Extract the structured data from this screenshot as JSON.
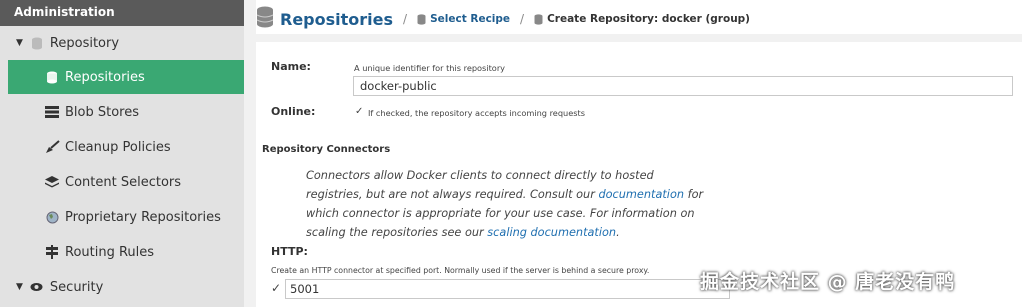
{
  "sidebar": {
    "header": "Administration",
    "group_repository": "Repository",
    "items": [
      {
        "label": "Repositories",
        "icon": "database-icon",
        "active": true
      },
      {
        "label": "Blob Stores",
        "icon": "server-icon"
      },
      {
        "label": "Cleanup Policies",
        "icon": "broom-icon"
      },
      {
        "label": "Content Selectors",
        "icon": "layers-icon"
      },
      {
        "label": "Proprietary Repositories",
        "icon": "globe-icon"
      },
      {
        "label": "Routing Rules",
        "icon": "signpost-icon"
      }
    ],
    "group_security": "Security"
  },
  "breadcrumb": {
    "title": "Repositories",
    "link": "Select Recipe",
    "current": "Create Repository: docker (group)"
  },
  "form": {
    "name_label": "Name:",
    "name_help": "A unique identifier for this repository",
    "name_value": "docker-public",
    "online_label": "Online:",
    "online_help": "If checked, the repository accepts incoming requests",
    "connectors_title": "Repository Connectors",
    "connectors_desc_1": "Connectors allow Docker clients to connect directly to hosted",
    "connectors_desc_2a": "registries, but are not always required. Consult our ",
    "connectors_desc_2_link": "documentation",
    "connectors_desc_2b": " for",
    "connectors_desc_3": "which connector is appropriate for your use case. For information on",
    "connectors_desc_4a": "scaling the repositories see our ",
    "connectors_desc_4_link": "scaling documentation",
    "connectors_desc_4b": ".",
    "http_label": "HTTP:",
    "http_help": "Create an HTTP connector at specified port. Normally used if the server is behind a secure proxy.",
    "http_port": "5001"
  },
  "watermark": "掘金技术社区 @ 唐老没有鸭",
  "colors": {
    "active": "#3aa873",
    "link": "#1f5d8f",
    "header": "#5a5a5a"
  }
}
